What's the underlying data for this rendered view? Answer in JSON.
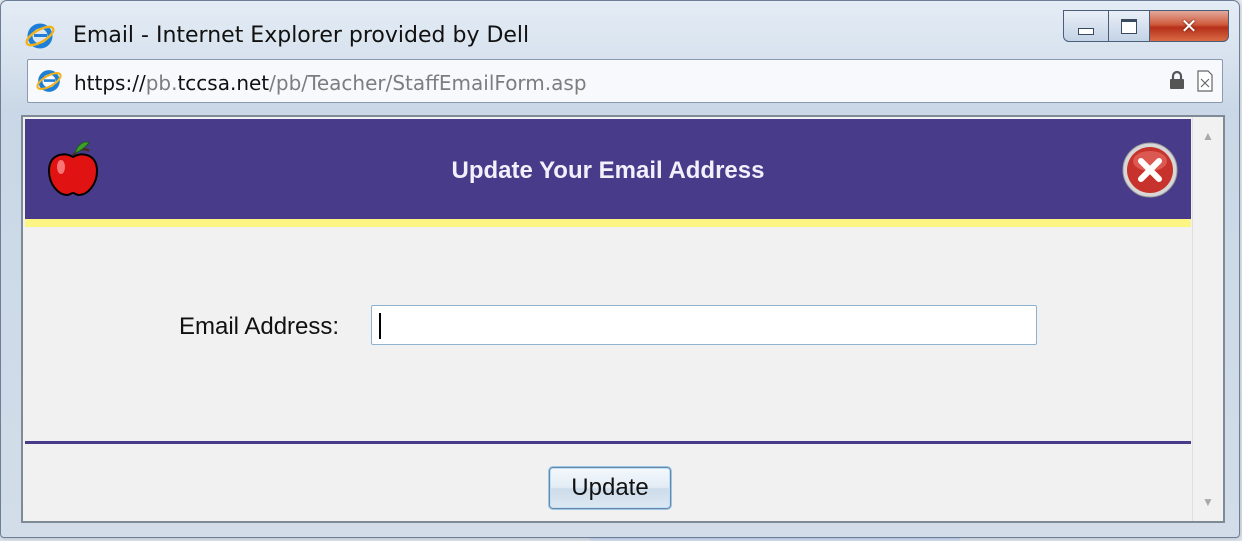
{
  "window": {
    "title": "Email - Internet Explorer provided by Dell",
    "controls": {
      "minimize": "minimize-icon",
      "maximize": "maximize-icon",
      "close": "close-icon"
    }
  },
  "address_bar": {
    "url_scheme": "https://",
    "url_sub": "pb.",
    "url_host": "tccsa.net",
    "url_path": "/pb/Teacher/StaffEmailForm.asp",
    "icons": [
      "ie-icon",
      "lock-icon",
      "page-icon"
    ]
  },
  "dialog": {
    "title": "Update Your Email Address",
    "logo_icon": "apple-icon",
    "close_icon": "close-circle-icon",
    "colors": {
      "header": "#473b8a",
      "accent_line": "#fdf583",
      "background": "#f1f1f1"
    }
  },
  "form": {
    "email_label": "Email Address:",
    "email_value": "",
    "email_placeholder": "",
    "submit_label": "Update"
  }
}
